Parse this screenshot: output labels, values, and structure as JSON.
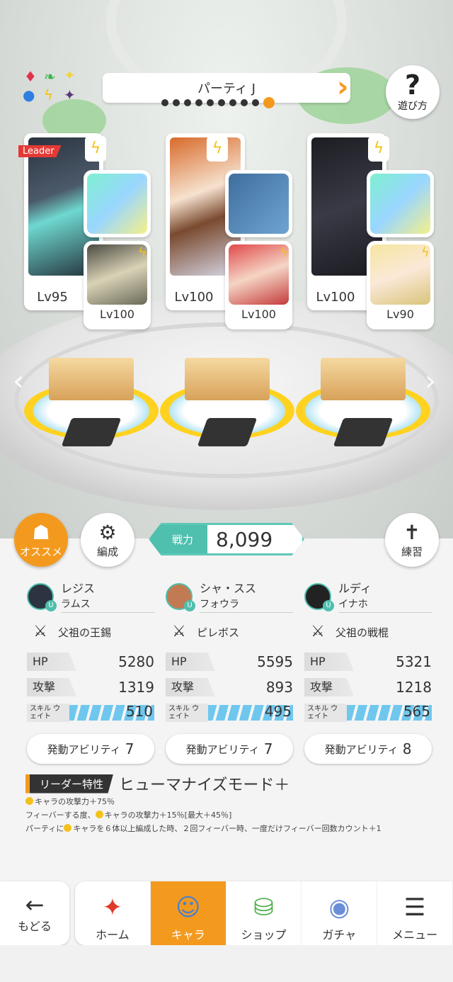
{
  "header": {
    "party_title": "パーティ J",
    "page_count": 10,
    "active_page": 10,
    "help_label": "遊び方"
  },
  "characters": [
    {
      "level": "Lv95",
      "leader_tag": "Leader",
      "sub_level": "Lv100"
    },
    {
      "level": "Lv100",
      "sub_level": "Lv100"
    },
    {
      "level": "Lv100",
      "sub_level": "Lv90"
    }
  ],
  "controls": {
    "recommend_label": "オススメ",
    "formation_label": "編成",
    "practice_label": "練習",
    "power_label": "戦力",
    "power_value": "8,099"
  },
  "members": [
    {
      "name": "レジス",
      "sub": "ラムス",
      "weapon": "父祖の王錫",
      "hp_label": "HP",
      "hp": "5280",
      "atk_label": "攻撃",
      "atk": "1319",
      "skill_label": "スキル ウェイト",
      "skill": "510",
      "ability_label": "発動アビリティ",
      "ability": "7"
    },
    {
      "name": "シャ・スス",
      "sub": "フォウラ",
      "weapon": "ピレボス",
      "hp_label": "HP",
      "hp": "5595",
      "atk_label": "攻撃",
      "atk": "893",
      "skill_label": "スキル ウェイト",
      "skill": "495",
      "ability_label": "発動アビリティ",
      "ability": "7"
    },
    {
      "name": "ルディ",
      "sub": "イナホ",
      "weapon": "父祖の戦棍",
      "hp_label": "HP",
      "hp": "5321",
      "atk_label": "攻撃",
      "atk": "1218",
      "skill_label": "スキル ウェイト",
      "skill": "565",
      "ability_label": "発動アビリティ",
      "ability": "8"
    }
  ],
  "leader": {
    "badge": "リーダー特性",
    "name": "ヒューマナイズモード＋",
    "line1": "キャラの攻撃力＋75％",
    "line2a": "フィーバーする度、",
    "line2b": "キャラの攻撃力＋15％[最大＋45％]",
    "line3a": "パーティに",
    "line3b": "キャラを６体以上編成した時、２回フィーバー時、一度だけフィーバー回数カウント＋1"
  },
  "nav": {
    "back": "もどる",
    "tabs": [
      "ホーム",
      "キャラ",
      "ショップ",
      "ガチャ",
      "メニュー"
    ]
  },
  "colors": {
    "accent": "#f39a1e",
    "teal": "#4fbfae",
    "skill_bar": "#6fc7ee"
  }
}
